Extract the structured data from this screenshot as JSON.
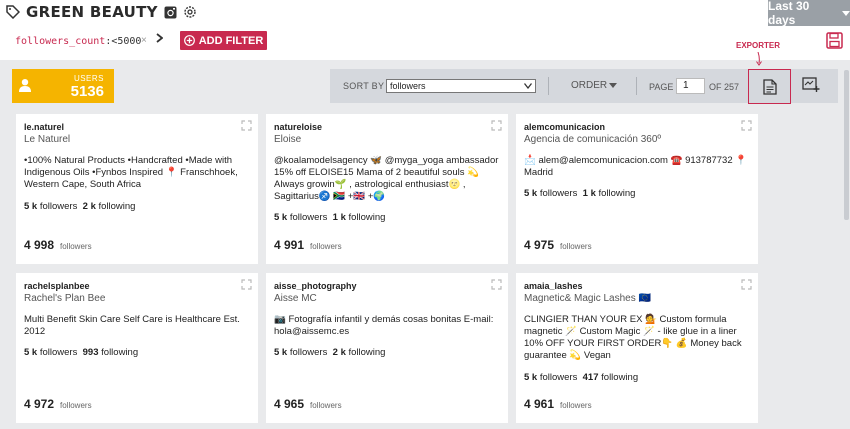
{
  "header": {
    "title": "GREEN BEAUTY",
    "date_range": "Last 30 days"
  },
  "filter": {
    "key": "followers_count",
    "op_value": ":<5000",
    "clear": "×",
    "add_label": "ADD FILTER"
  },
  "exporter_callout": "EXPORTER",
  "users": {
    "label": "USERS",
    "count": "5136"
  },
  "toolbar": {
    "sort_by_label": "SORT BY",
    "sort_value": "followers",
    "order_label": "ORDER",
    "page_label": "PAGE",
    "page_value": "1",
    "of_label": "OF 257"
  },
  "cards": [
    {
      "handle": "le.naturel",
      "name": "Le Naturel",
      "bio": "•100% Natural Products •Handcrafted •Made with Indigenous Oils •Fynbos Inspired 📍 Franschhoek, Western Cape, South Africa",
      "followers": "5 k",
      "following": "2 k",
      "count": "4 998",
      "followers_word": "followers",
      "following_word": "following",
      "count_label": "followers"
    },
    {
      "handle": "natureloise",
      "name": "Eloise",
      "bio": "@koalamodelsagency 🦋 @myga_yoga ambassador 15% off ELOISE15 Mama of 2 beautiful souls 💫 Always growin🌱 , astrological enthusiast🌝 , Sagittarius♐ 🇿🇦 +🇬🇧 +🌍",
      "followers": "5 k",
      "following": "1 k",
      "count": "4 991",
      "followers_word": "followers",
      "following_word": "following",
      "count_label": "followers"
    },
    {
      "handle": "alemcomunicacion",
      "name": "Agencia de comunicación 360º",
      "bio": "📩 alem@alemcomunicacion.com ☎️ 913787732 📍 Madrid",
      "followers": "5 k",
      "following": "1 k",
      "count": "4 975",
      "followers_word": "followers",
      "following_word": "following",
      "count_label": "followers"
    },
    {
      "handle": "rachelsplanbee",
      "name": "Rachel's Plan Bee",
      "bio": "Multi Benefit Skin Care Self Care is Healthcare Est. 2012",
      "followers": "5 k",
      "following": "993",
      "count": "4 972",
      "followers_word": "followers",
      "following_word": "following",
      "count_label": "followers"
    },
    {
      "handle": "aisse_photography",
      "name": "Aisse MC",
      "bio": "📷 Fotografía infantil y demás cosas bonitas E-mail: hola@aissemc.es",
      "followers": "5 k",
      "following": "2 k",
      "count": "4 965",
      "followers_word": "followers",
      "following_word": "following",
      "count_label": "followers"
    },
    {
      "handle": "amaia_lashes",
      "name": "Magnetic& Magic Lashes 🇪🇺",
      "bio": "CLINGIER THAN YOUR EX 💁 Custom formula magnetic 🪄 Custom Magic 🪄 - like glue in a liner 10% OFF YOUR FIRST ORDER👇 💰 Money back guarantee 💫 Vegan",
      "followers": "5 k",
      "following": "417",
      "count": "4 961",
      "followers_word": "followers",
      "following_word": "following",
      "count_label": "followers"
    }
  ],
  "colors": {
    "accent": "#c8294f",
    "users_box": "#f5b400",
    "toolbar": "#d5d8dd",
    "date_range_bg": "#9aa0a6"
  }
}
